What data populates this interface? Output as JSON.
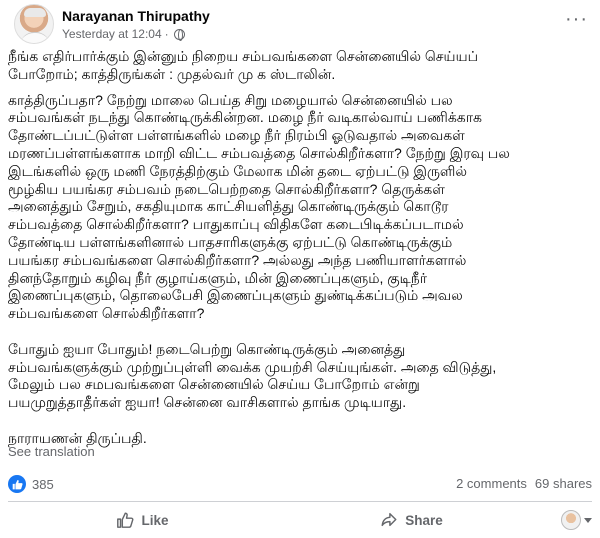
{
  "post": {
    "author": "Narayanan Thirupathy",
    "timestamp": "Yesterday at 12:04",
    "separator": "·",
    "more_menu": "···",
    "paragraphs": [
      "நீங்க எதிர்பார்க்கும் இன்னும் நிறைய சம்பவங்களை சென்னையில் செய்யப்\nபோறோம்; காத்திருங்கள் : முதல்வர் மு க ஸ்டாலின்.",
      "காத்திருப்பதா? நேற்று மாலை பெய்த சிறு மழையால் சென்னையில் பல\nசம்பவங்கள் நடந்து கொண்டிருக்கின்றன. மழை நீர் வடிகால்வாய் பணிக்காக\nதோண்டப்பட்டுள்ள பள்ளங்களில் மழை நீர் நிரம்பி ஓடுவதால் அவைகள்\nமரணப்பள்ளங்களாக மாறி விட்ட சம்பவத்தை சொல்கிறீர்களா? நேற்று இரவு பல\nஇடங்களில் ஒரு மணி நேரத்திற்கும் மேலாக மின் தடை ஏற்பட்டு இருளில்\nமூழ்கிய பயங்கர சம்பவம் நடைபெற்றதை சொல்கிறீர்களா? தெருக்கள்\nஅனைத்தும் சேறும், சகதியுமாக காட்சியளித்து கொண்டிருக்கும் கொடூர\nசம்பவத்தை சொல்கிறீர்களா? பாதுகாப்பு விதிகளே கடைபிடிக்கப்படாமல்\nதோண்டிய பள்ளங்களினால் பாதசாரிகளுக்கு ஏற்பட்டு கொண்டிருக்கும்\nபயங்கர சம்பவங்களை சொல்கிறீர்களா? அல்லது அந்த பணியாளர்களால்\nதினந்தோறும் கழிவு நீர் குழாய்களும், மின் இணைப்புகளும், குடிநீர்\nஇணைப்புகளும், தொலைபேசி இணைப்புகளும் துண்டிக்கப்படும் அவல\nசம்பவங்களை சொல்கிறீர்களா?",
      "போதும் ஐயா போதும்! நடைபெற்று கொண்டிருக்கும் அனைத்து\nசம்பவங்களுக்கும் முற்றுப்புள்ளி வைக்க முயற்சி செய்யுங்கள். அதை விடுத்து,\nமேலும் பல சமபவங்களை சென்னையில் செய்ய போறோம் என்று\nபயமுறுத்தாதீர்கள் ஐயா! சென்னை வாசிகளால் தாங்க முடியாது.",
      "நாராயணன் திருப்பதி."
    ],
    "see_translation": "See translation"
  },
  "engagement": {
    "reaction_count": "385",
    "comments": "2 comments",
    "shares": "69 shares"
  },
  "actions": {
    "like_label": "Like",
    "share_label": "Share"
  },
  "colors": {
    "accent": "#1877f2",
    "secondary_text": "#65676b",
    "divider": "#ced0d4"
  },
  "icons": [
    "globe-icon",
    "more-icon",
    "like-badge-icon",
    "like-icon",
    "share-icon",
    "caret-icon"
  ]
}
